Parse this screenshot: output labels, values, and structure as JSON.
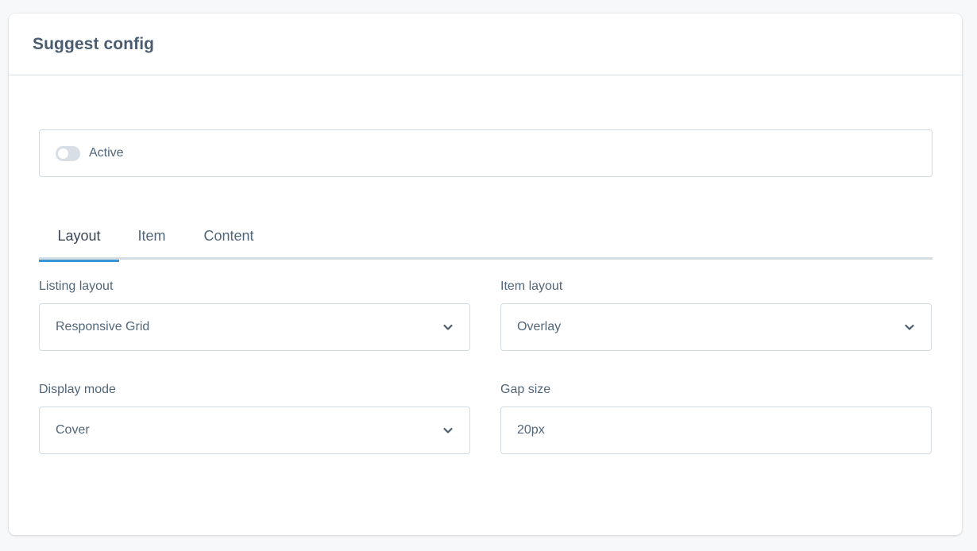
{
  "card": {
    "title": "Suggest config"
  },
  "active_toggle": {
    "label": "Active",
    "checked": false
  },
  "tabs": [
    {
      "label": "Layout",
      "active": true
    },
    {
      "label": "Item",
      "active": false
    },
    {
      "label": "Content",
      "active": false
    }
  ],
  "fields": {
    "listing_layout": {
      "label": "Listing layout",
      "value": "Responsive Grid"
    },
    "item_layout": {
      "label": "Item layout",
      "value": "Overlay"
    },
    "display_mode": {
      "label": "Display mode",
      "value": "Cover"
    },
    "gap_size": {
      "label": "Gap size",
      "value": "20px"
    }
  },
  "colors": {
    "accent": "#3a95d4",
    "border": "#d1dbe1",
    "text": "#52667a"
  }
}
